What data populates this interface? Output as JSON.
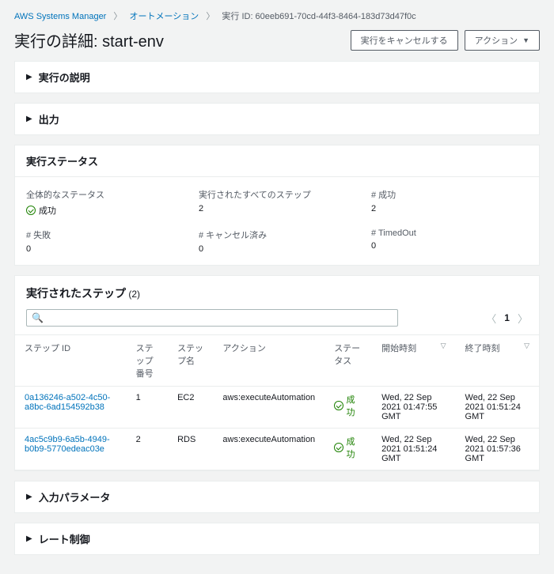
{
  "breadcrumb": {
    "root": "AWS Systems Manager",
    "automation": "オートメーション",
    "current": "実行 ID: 60eeb691-70cd-44f3-8464-183d73d47f0c"
  },
  "header": {
    "title": "実行の詳細: start-env",
    "cancel": "実行をキャンセルする",
    "actions": "アクション"
  },
  "sections": {
    "description": "実行の説明",
    "output": "出力",
    "status": "実行ステータス",
    "steps": "実行されたステップ",
    "steps_count": "(2)",
    "input": "入力パラメータ",
    "rate": "レート制御"
  },
  "status": {
    "overall_label": "全体的なステータス",
    "overall_value": "成功",
    "all_steps_label": "実行されたすべてのステップ",
    "all_steps_value": "2",
    "success_label": "# 成功",
    "success_value": "2",
    "failed_label": "# 失敗",
    "failed_value": "0",
    "cancelled_label": "# キャンセル済み",
    "cancelled_value": "0",
    "timedout_label": "# TimedOut",
    "timedout_value": "0"
  },
  "table": {
    "headers": {
      "step_id": "ステップ ID",
      "step_num": "ステップ番号",
      "step_name": "ステップ名",
      "action": "アクション",
      "status": "ステータス",
      "start": "開始時刻",
      "end": "終了時刻"
    },
    "rows": [
      {
        "id": "0a136246-a502-4c50-a8bc-6ad154592b38",
        "num": "1",
        "name": "EC2",
        "action": "aws:executeAutomation",
        "status": "成功",
        "start": "Wed, 22 Sep 2021 01:47:55 GMT",
        "end": "Wed, 22 Sep 2021 01:51:24 GMT"
      },
      {
        "id": "4ac5c9b9-6a5b-4949-b0b9-5770edeac03e",
        "num": "2",
        "name": "RDS",
        "action": "aws:executeAutomation",
        "status": "成功",
        "start": "Wed, 22 Sep 2021 01:51:24 GMT",
        "end": "Wed, 22 Sep 2021 01:57:36 GMT"
      }
    ]
  },
  "pager": {
    "page": "1"
  }
}
